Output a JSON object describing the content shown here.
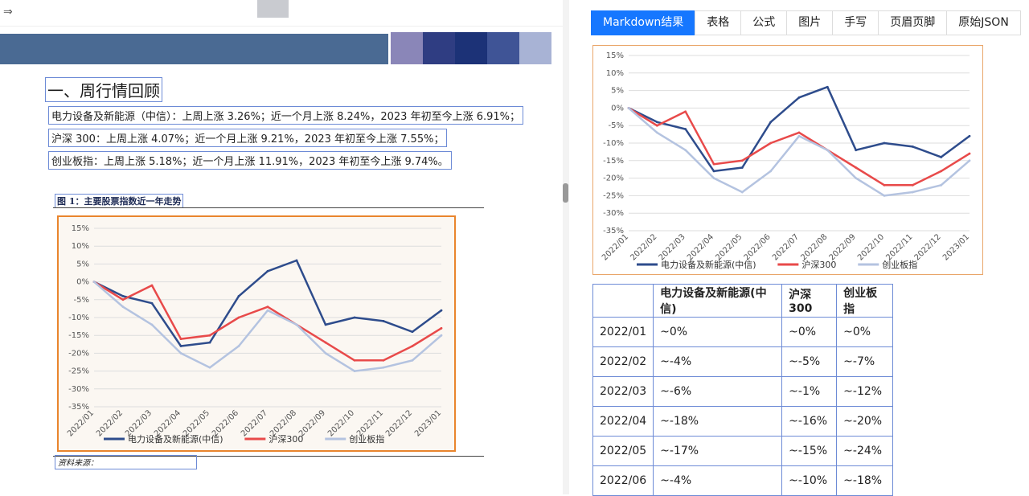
{
  "toolbar": {
    "expand_icon": "⇒"
  },
  "document": {
    "heading": "一、周行情回顾",
    "lines": [
      "电力设备及新能源（中信）：上周上涨 3.26%；近一个月上涨 8.24%，2023 年初至今上涨 6.91%；",
      "沪深 300：上周上涨 4.07%；近一个月上涨 9.21%，2023 年初至今上涨 7.55%；",
      "创业板指：上周上涨 5.18%；近一个月上涨 11.91%，2023 年初至今上涨 9.74%。"
    ],
    "figure_caption": "图 1：主要股票指数近一年走势",
    "source_note": "资料来源："
  },
  "tabs": [
    {
      "label": "Markdown结果",
      "active": true
    },
    {
      "label": "表格",
      "active": false
    },
    {
      "label": "公式",
      "active": false
    },
    {
      "label": "图片",
      "active": false
    },
    {
      "label": "手写",
      "active": false
    },
    {
      "label": "页眉页脚",
      "active": false
    },
    {
      "label": "原始JSON",
      "active": false
    }
  ],
  "table": {
    "headers": [
      "",
      "电力设备及新能源(中信)",
      "沪深300",
      "创业板指"
    ],
    "rows": [
      [
        "2022/01",
        "~0%",
        "~0%",
        "~0%"
      ],
      [
        "2022/02",
        "~-4%",
        "~-5%",
        "~-7%"
      ],
      [
        "2022/03",
        "~-6%",
        "~-1%",
        "~-12%"
      ],
      [
        "2022/04",
        "~-18%",
        "~-16%",
        "~-20%"
      ],
      [
        "2022/05",
        "~-17%",
        "~-15%",
        "~-24%"
      ],
      [
        "2022/06",
        "~-4%",
        "~-10%",
        "~-18%"
      ]
    ]
  },
  "chart_data": [
    {
      "type": "line",
      "x": [
        "2022/01",
        "2022/02",
        "2022/03",
        "2022/04",
        "2022/05",
        "2022/06",
        "2022/07",
        "2022/08",
        "2022/09",
        "2022/10",
        "2022/11",
        "2022/12",
        "2023/01"
      ],
      "ylim": [
        -35,
        15
      ],
      "yticks": [
        "15%",
        "10%",
        "5%",
        "0%",
        "-5%",
        "-10%",
        "-15%",
        "-20%",
        "-25%",
        "-30%",
        "-35%"
      ],
      "legend_position": "bottom",
      "series": [
        {
          "name": "电力设备及新能源(中信)",
          "color": "#2e4c8c",
          "values": [
            0,
            -4,
            -6,
            -18,
            -17,
            -4,
            3,
            6,
            -12,
            -10,
            -11,
            -14,
            -8
          ]
        },
        {
          "name": "沪深300",
          "color": "#e84a4a",
          "values": [
            0,
            -5,
            -1,
            -16,
            -15,
            -10,
            -7,
            -12,
            -17,
            -22,
            -22,
            -18,
            -13
          ]
        },
        {
          "name": "创业板指",
          "color": "#b4c3e0",
          "values": [
            0,
            -7,
            -12,
            -20,
            -24,
            -18,
            -8,
            -12,
            -20,
            -25,
            -24,
            -22,
            -15
          ]
        }
      ]
    },
    {
      "type": "line",
      "x": [
        "2022/01",
        "2022/02",
        "2022/03",
        "2022/04",
        "2022/05",
        "2022/06",
        "2022/07",
        "2022/08",
        "2022/09",
        "2022/10",
        "2022/11",
        "2022/12",
        "2023/01"
      ],
      "ylim": [
        -35,
        15
      ],
      "yticks": [
        "15%",
        "10%",
        "5%",
        "0%",
        "-5%",
        "-10%",
        "-15%",
        "-20%",
        "-25%",
        "-30%",
        "-35%"
      ],
      "legend_position": "bottom",
      "series": [
        {
          "name": "电力设备及新能源(中信)",
          "color": "#2e4c8c",
          "values": [
            0,
            -4,
            -6,
            -18,
            -17,
            -4,
            3,
            6,
            -12,
            -10,
            -11,
            -14,
            -8
          ]
        },
        {
          "name": "沪深300",
          "color": "#e84a4a",
          "values": [
            0,
            -5,
            -1,
            -16,
            -15,
            -10,
            -7,
            -12,
            -17,
            -22,
            -22,
            -18,
            -13
          ]
        },
        {
          "name": "创业板指",
          "color": "#b4c3e0",
          "values": [
            0,
            -7,
            -12,
            -20,
            -24,
            -18,
            -8,
            -12,
            -20,
            -25,
            -24,
            -22,
            -15
          ]
        }
      ]
    }
  ]
}
